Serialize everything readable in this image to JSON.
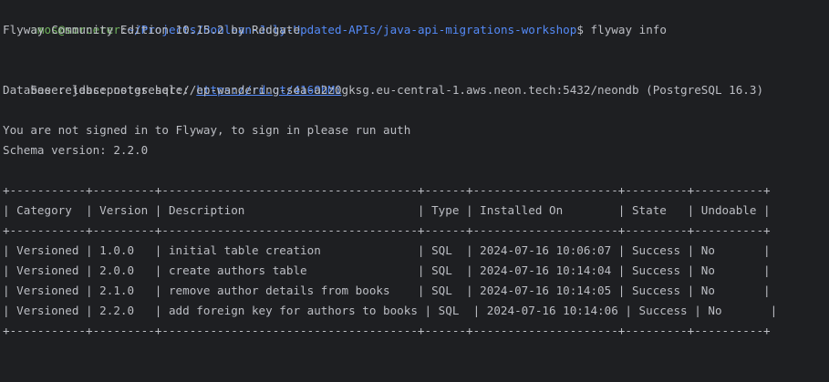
{
  "prompt": {
    "user_host": "amos@sorcerer",
    "separator": ":",
    "path": "~/Projects/Boolean-July-Updated-APIs/java-api-migrations-workshop",
    "symbol": "$ "
  },
  "command": "flyway info",
  "output": {
    "edition": "Flyway Community Edition 10.15.2 by Redgate",
    "release_notes_label": "See release notes here: ",
    "release_notes_url": "https://rd.gt/416ObMi",
    "database": "Database: jdbc:postgresql://ep-wandering-sea-a2z0gksg.eu-central-1.aws.neon.tech:5432/neondb (PostgreSQL 16.3)",
    "signin": "You are not signed in to Flyway, to sign in please run auth",
    "schema_version": "Schema version: 2.2.0"
  },
  "table": {
    "border": "+-----------+---------+-------------------------------------+------+---------------------+---------+----------+",
    "header": "| Category  | Version | Description                         | Type | Installed On        | State   | Undoable |",
    "columns": [
      "Category",
      "Version",
      "Description",
      "Type",
      "Installed On",
      "State",
      "Undoable"
    ],
    "rows": [
      "| Versioned | 1.0.0   | initial table creation              | SQL  | 2024-07-16 10:06:07 | Success | No       |",
      "| Versioned | 2.0.0   | create authors table                | SQL  | 2024-07-16 10:14:04 | Success | No       |",
      "| Versioned | 2.1.0   | remove author details from books    | SQL  | 2024-07-16 10:14:05 | Success | No       |",
      "| Versioned | 2.2.0   | add foreign key for authors to books | SQL  | 2024-07-16 10:14:06 | Success | No       |"
    ]
  },
  "colors": {
    "background": "#1e1f22",
    "text": "#bcbec4",
    "user": "#6fb25b",
    "path": "#548af7",
    "link": "#548af7"
  }
}
